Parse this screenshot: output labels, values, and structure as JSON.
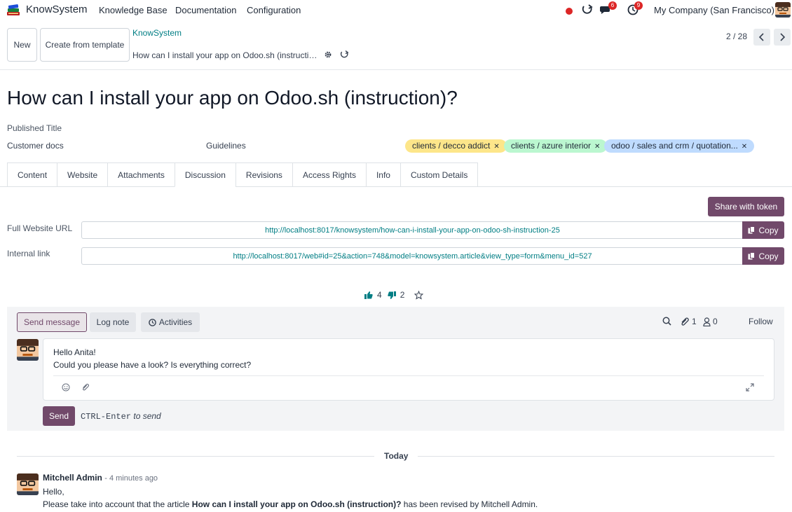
{
  "navbar": {
    "app_name": "KnowSystem",
    "menu": [
      "Knowledge Base",
      "Documentation",
      "Configuration"
    ],
    "messages_count": "6",
    "activities_count": "9",
    "company": "My Company (San Francisco)"
  },
  "control": {
    "new_label": "New",
    "template_label": "Create from template",
    "breadcrumb_parent": "KnowSystem",
    "breadcrumb_current": "How can I install your app on Odoo.sh (instruction)?",
    "pager": "2 / 28"
  },
  "article": {
    "title": "How can I install your app on Odoo.sh (instruction)?",
    "published_label": "Published Title",
    "section": "Customer docs",
    "type": "Guidelines",
    "tags": [
      {
        "label": "clients / decco addict",
        "color": "#fde68a"
      },
      {
        "label": "clients / azure interior",
        "color": "#bbf7d0"
      },
      {
        "label": "odoo / sales and crm / quotation...",
        "color": "#bfdbfe"
      }
    ]
  },
  "tabs": [
    "Content",
    "Website",
    "Attachments",
    "Discussion",
    "Revisions",
    "Access Rights",
    "Info",
    "Custom Details"
  ],
  "active_tab": "Discussion",
  "discussion": {
    "share_label": "Share with token",
    "full_url_label": "Full Website URL",
    "full_url": "http://localhost:8017/knowsystem/how-can-i-install-your-app-on-odoo-sh-instruction-25",
    "internal_label": "Internal link",
    "internal_url": "http://localhost:8017/web#id=25&action=748&model=knowsystem.article&view_type=form&menu_id=527",
    "copy_label": "Copy",
    "likes": "4",
    "dislikes": "2"
  },
  "chatter": {
    "send_message": "Send message",
    "log_note": "Log note",
    "activities": "Activities",
    "attachments_count": "1",
    "followers_count": "0",
    "follow": "Follow",
    "composer_line1": "Hello Anita!",
    "composer_line2": "Could you please have a look? Is everything correct?",
    "send": "Send",
    "hint_key": "CTRL-Enter",
    "hint_text": "to send",
    "today": "Today",
    "message": {
      "author": "Mitchell Admin",
      "time": "- 4 minutes ago",
      "line1": "Hello,",
      "line2_pre": "Please take into account that the article ",
      "line2_bold": "How can I install your app on Odoo.sh (instruction)?",
      "line2_post": " has been revised by Mitchell Admin."
    }
  },
  "colors": {
    "primary": "#71496a",
    "link": "#017e84",
    "notification": "#dc2626"
  }
}
